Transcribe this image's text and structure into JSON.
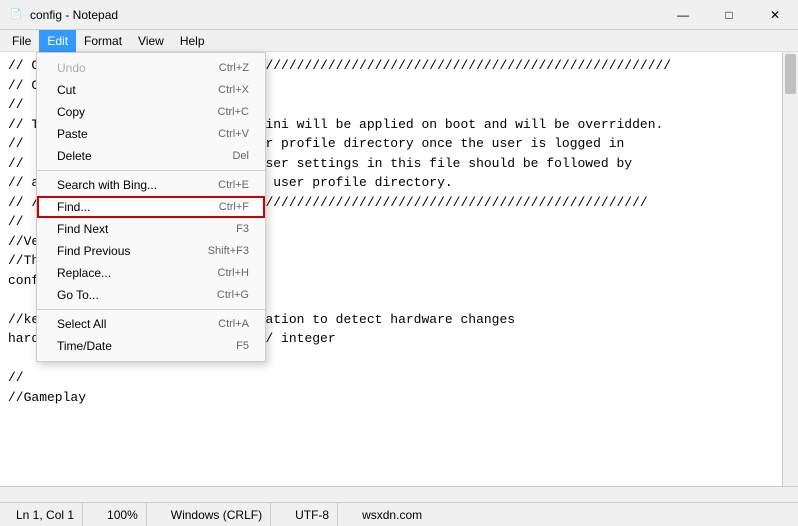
{
  "titleBar": {
    "icon": "📄",
    "title": "config - Notepad",
    "buttons": {
      "minimize": "—",
      "maximize": "□",
      "close": "✕"
    }
  },
  "menuBar": {
    "items": [
      "File",
      "Edit",
      "Format",
      "View",
      "Help"
    ]
  },
  "editMenu": {
    "items": [
      {
        "label": "Undo",
        "shortcut": "Ctrl+Z",
        "disabled": true
      },
      {
        "label": "Cut",
        "shortcut": "Ctrl+X"
      },
      {
        "label": "Copy",
        "shortcut": "Ctrl+C"
      },
      {
        "label": "Paste",
        "shortcut": "Ctrl+V"
      },
      {
        "label": "Delete",
        "shortcut": "Del"
      },
      {
        "separator": true
      },
      {
        "label": "Search with Bing...",
        "shortcut": "Ctrl+E"
      },
      {
        "label": "Find...",
        "shortcut": "Ctrl+F",
        "highlighted": true
      },
      {
        "label": "Find Next",
        "shortcut": "F3"
      },
      {
        "label": "Find Previous",
        "shortcut": "Shift+F3"
      },
      {
        "label": "Replace...",
        "shortcut": "Ctrl+H"
      },
      {
        "label": "Go To...",
        "shortcut": "Ctrl+G"
      },
      {
        "separator": true
      },
      {
        "label": "Select All",
        "shortcut": "Ctrl+A"
      },
      {
        "label": "Time/Date",
        "shortcut": "F5"
      }
    ]
  },
  "editorContent": "// C\\\\//////////////////////////////////////////////////////////////////////////////////\n// C\\\\g.ini\n//\n// T                    ayers/config.ini will be applied on boot and will be overridden.\n//                      nd in the user profile directory once the user is logged in\n//                      tion of the user settings in this file should be followed by\n// a                    in the proper user profile directory.\n// /////////////////////////////////////////////////////////////////////////////////\n//\n//Ve\n//Th\nconfig_version = 7 // 0 or bigger\n\n//keep track of hardware configuration to detect hardware changes\nhardware_checksum = \"464945276\" // integer\n\n//\n//Gameplay",
  "statusBar": {
    "position": "Ln 1, Col 1",
    "zoom": "100%",
    "lineEnding": "Windows (CRLF)",
    "encoding": "UTF-8",
    "extra": "wsxdn.com"
  }
}
